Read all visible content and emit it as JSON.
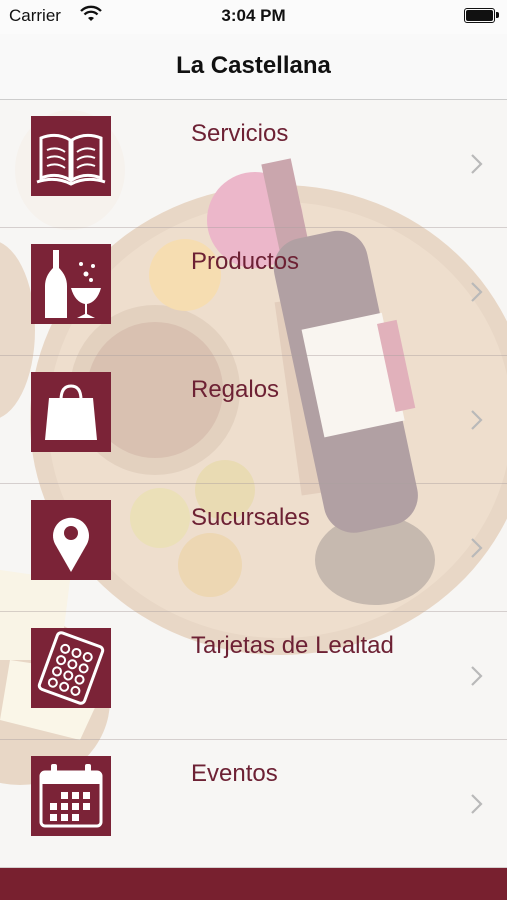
{
  "status_bar": {
    "carrier": "Carrier",
    "time": "3:04 PM",
    "wifi_icon": "wifi-icon",
    "battery_icon": "battery-icon"
  },
  "nav": {
    "title": "La Castellana"
  },
  "menu": {
    "items": [
      {
        "label": "Servicios",
        "icon": "book-icon"
      },
      {
        "label": "Productos",
        "icon": "wine-bottle-glass-icon"
      },
      {
        "label": "Regalos",
        "icon": "shopping-bag-icon"
      },
      {
        "label": "Sucursales",
        "icon": "map-pin-icon"
      },
      {
        "label": "Tarjetas de Lealtad",
        "icon": "loyalty-card-icon"
      },
      {
        "label": "Eventos",
        "icon": "calendar-icon"
      }
    ],
    "chevron_icon": "chevron-right-icon"
  },
  "colors": {
    "brand": "#7b2337",
    "label": "#6d2134",
    "bottom_bar": "#78202f"
  }
}
